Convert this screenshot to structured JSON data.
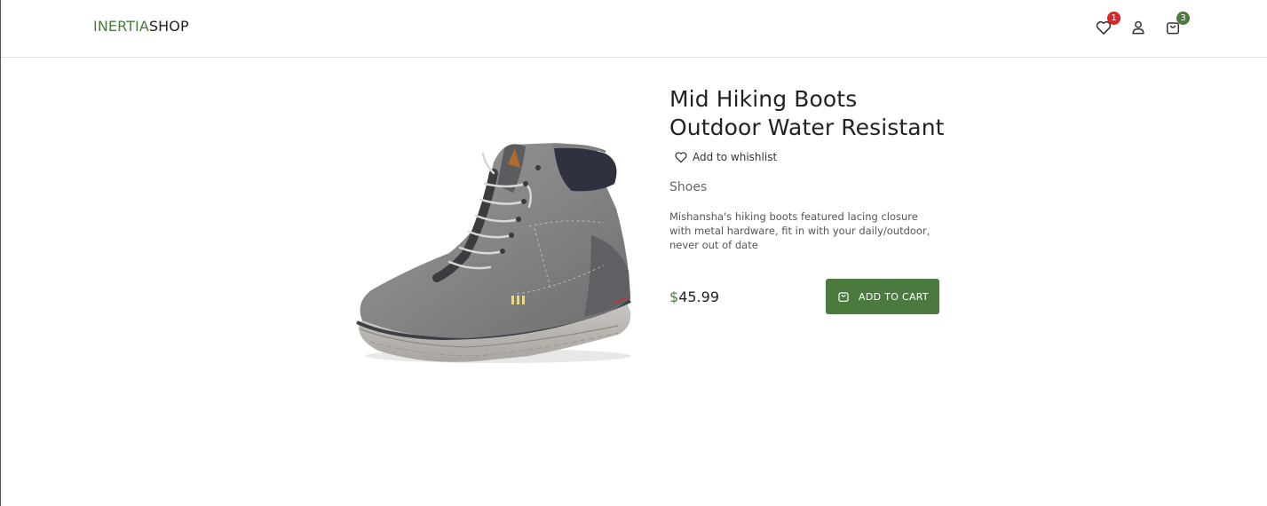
{
  "header": {
    "logo_part1": "INERTIA",
    "logo_part2": "SHOP",
    "wishlist_count": "1",
    "cart_count": "3",
    "icons": [
      "heart-icon",
      "user-icon",
      "shopping-bag-icon"
    ]
  },
  "product": {
    "image_icon": "hiking-boot-image",
    "title": "Mid Hiking Boots Outdoor Water Resistant",
    "wishlist_label": "Add to whishlist",
    "category": "Shoes",
    "description": "Mishansha's hiking boots featured lacing closure with metal hardware, fit in with your daily/outdoor, never out of date",
    "currency": "$",
    "price": "45.99",
    "add_to_cart_label": "ADD TO CART"
  },
  "colors": {
    "accent": "#4c7a3e",
    "wishlist_badge": "#dc2626",
    "cart_badge": "#4c7a3e"
  }
}
